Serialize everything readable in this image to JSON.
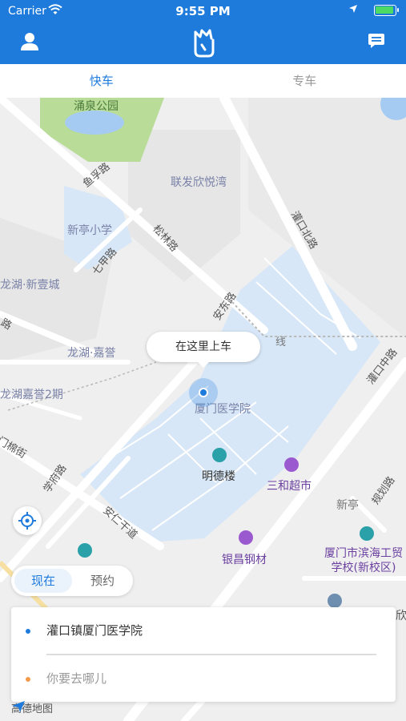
{
  "status": {
    "carrier": "Carrier",
    "time": "9:55 PM"
  },
  "tabs": {
    "express": "快车",
    "premium": "专车"
  },
  "map": {
    "labels": {
      "yongquan_park": "涌泉公园",
      "lianfa": "联发欣悦湾",
      "xinting_school": "新亭小学",
      "longhu_xinyi": "龙湖·新壹城",
      "longhu_jiayu": "龙湖·嘉誉",
      "longhu_jiayu2": "龙湖嘉誉2期",
      "medical_college": "厦门医学院",
      "mingde": "明德楼",
      "sanhe": "三和超市",
      "xinting": "新亭",
      "yinchang": "银昌钢材",
      "binhai_school": "厦门市滨海工贸\n学校(新校区)",
      "line": "线",
      "right_edge": "欣"
    },
    "roads": {
      "yuqiao": "鱼孚路",
      "songlin": "松林路",
      "qijia": "七甲路",
      "guankou_north": "灌口北路",
      "andong": "安东路",
      "guankou_middle": "灌口中路",
      "mianjie": "门棉街",
      "xueyuan": "学府路",
      "anren": "安仁干道",
      "guihua": "规划路",
      "road_left": "路"
    },
    "pickup_bubble": "在这里上车"
  },
  "time_options": {
    "now": "现在",
    "later": "预约"
  },
  "route": {
    "from": "灌口镇厦门医学院",
    "to_placeholder": "你要去哪儿"
  },
  "attribution": "高德地图",
  "colors": {
    "primary": "#1e7bdc",
    "campus": "#d7e7f7",
    "park": "#b9dc98",
    "water": "#a6cbf2",
    "destination_dot": "#f39a4b"
  }
}
